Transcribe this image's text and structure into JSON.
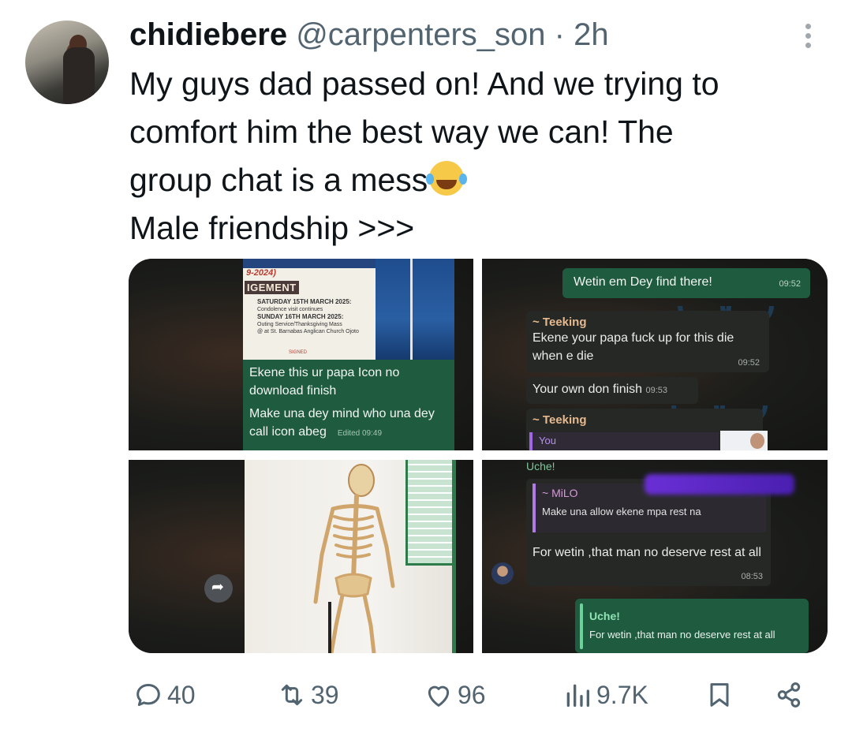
{
  "author": {
    "name": "chidiebere",
    "handle": "@carpenters_son",
    "separator": "·",
    "time": "2h"
  },
  "tweet": {
    "lines": [
      "My guys dad passed on! And we trying to",
      "comfort him the best way we can! The",
      "group chat is a mess",
      "Male friendship >>>"
    ],
    "emoji": "face-with-tears-of-joy"
  },
  "media": {
    "cell1": {
      "poster_years": "9-2024)",
      "poster_ack": "IGEMENT",
      "poster_line1": "SATURDAY 15TH MARCH 2025:",
      "poster_line2": "Condolence visit continues",
      "poster_line3": "SUNDAY 16TH MARCH 2025:",
      "poster_line4": "Outing Service/Thanksgiving Mass",
      "poster_line5": "@ at St. Barnabas Anglican Church Ojoto",
      "poster_signed": "SIGNED",
      "message": "Ekene this ur papa Icon no download finish",
      "message2": "Make una dey mind who una dey call icon abeg",
      "edited": "Edited 09:49"
    },
    "cell2": {
      "out_text": "Wetin em Dey find there!",
      "out_time": "09:52",
      "sender1": "~ Teeking",
      "msg1": "Ekene your papa fuck up for this die when e die",
      "time1": "09:52",
      "msg2": "Your own don finish",
      "time2": "09:53",
      "sender2": "~ Teeking",
      "quote_you": "You"
    },
    "cell4": {
      "top_name": "Uche!",
      "quote_sender": "~ MiLO",
      "quote_msg": "Make una allow ekene mpa rest na",
      "reply": "For wetin ,that man no deserve rest at all",
      "reply_time": "08:53",
      "out_name": "Uche!",
      "out_msg": "For wetin ,that man no deserve rest at all"
    }
  },
  "actions": {
    "replies": "40",
    "reposts": "39",
    "likes": "96",
    "views": "9.7K"
  },
  "colors": {
    "text": "#0f1419",
    "muted": "#536471",
    "wa_green": "#1f5c3f"
  }
}
